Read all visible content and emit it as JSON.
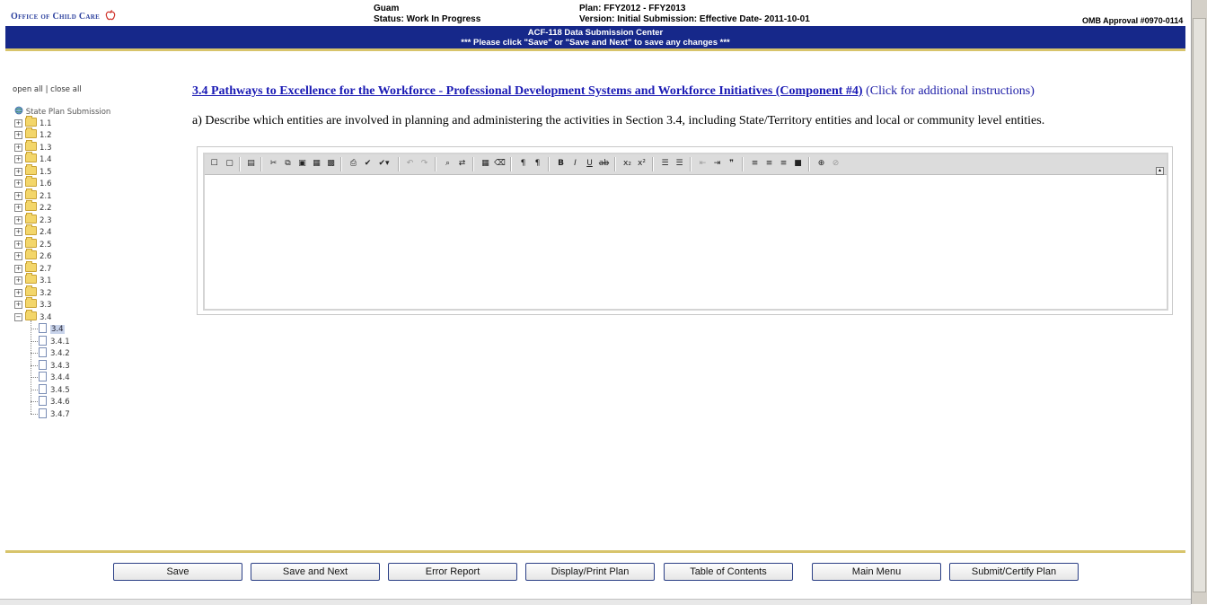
{
  "header": {
    "logo": "Office of Child Care",
    "state": "Guam",
    "status": "Status: Work In Progress",
    "plan": "Plan: FFY2012 - FFY2013",
    "version": "Version: Initial Submission: Effective Date- 2011-10-01",
    "omb": "OMB Approval #0970-0114",
    "band_title": "ACF-118 Data Submission Center",
    "band_note": "*** Please click \"Save\" or \"Save and Next\" to save any changes ***"
  },
  "tree": {
    "open_all": "open all",
    "separator": "|",
    "close_all": "close all",
    "root": "State Plan Submission",
    "folders": [
      "1.1",
      "1.2",
      "1.3",
      "1.4",
      "1.5",
      "1.6",
      "2.1",
      "2.2",
      "2.3",
      "2.4",
      "2.5",
      "2.6",
      "2.7",
      "3.1",
      "3.2",
      "3.3",
      "3.4"
    ],
    "children": [
      "3.4",
      "3.4.1",
      "3.4.2",
      "3.4.3",
      "3.4.4",
      "3.4.5",
      "3.4.6",
      "3.4.7"
    ]
  },
  "main": {
    "heading_link": "3.4 Pathways to Excellence for the Workforce - Professional Development Systems and Workforce Initiatives (Component #4)",
    "heading_note": "(Click for additional instructions)",
    "question": "a) Describe which entities are involved in planning and administering the activities in Section 3.4, including State/Territory entities and local or community level entities."
  },
  "footer": {
    "buttons": [
      "Save",
      "Save and Next",
      "Error Report",
      "Display/Print Plan",
      "Table of Contents",
      "Main Menu",
      "Submit/Certify Plan"
    ]
  },
  "colors": {
    "band": "#16288a",
    "accent_line": "#d8c46b",
    "link": "#1a1ab4"
  }
}
